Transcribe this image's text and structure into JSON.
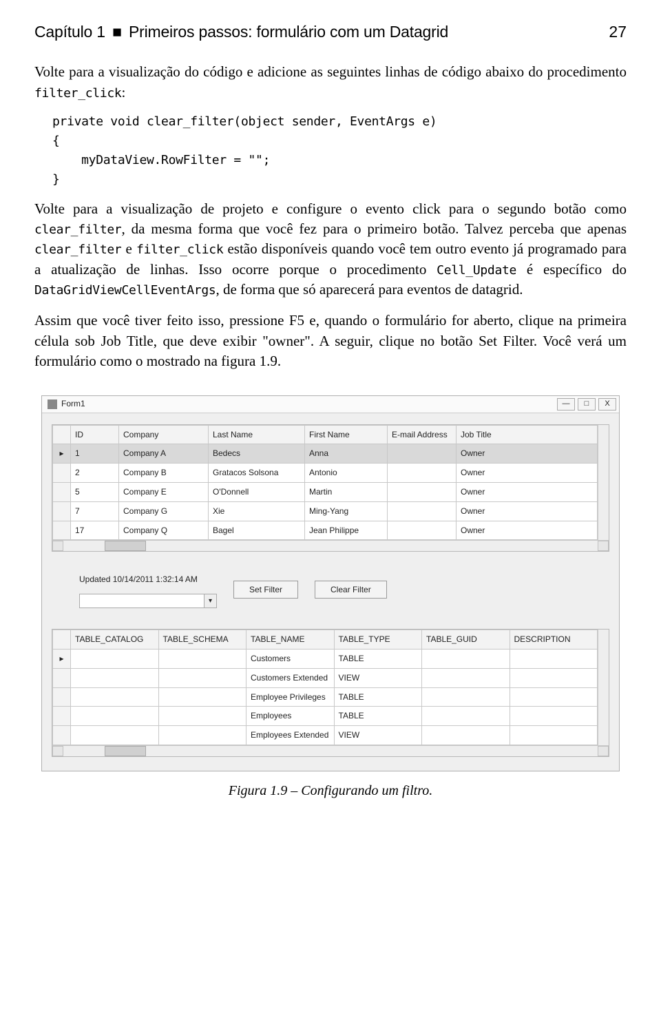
{
  "header": {
    "chapter_label": "Capítulo 1",
    "separator": "■",
    "chapter_subtitle": "Primeiros passos: formulário com um Datagrid",
    "page_number": "27"
  },
  "paragraphs": {
    "p1_a": "Volte para a visualização do código e adicione as seguintes linhas de código abaixo do procedimento ",
    "p1_code": "filter_click",
    "p1_b": ":",
    "code_block": "private void clear_filter(object sender, EventArgs e)\n{\n    myDataView.RowFilter = \"\";\n}",
    "p2_a": "Volte para a visualização de projeto e configure o evento click para o segundo botão como ",
    "p2_code1": "clear_filter",
    "p2_b": ", da mesma forma que você fez para o primeiro botão. Talvez perceba que apenas ",
    "p2_code2": "clear_filter",
    "p2_c": " e ",
    "p2_code3": "filter_click",
    "p2_d": " estão disponíveis quando você tem outro evento já programado para a atualização de linhas. Isso ocorre porque o procedimento ",
    "p2_code4": "Cell_Update",
    "p2_e": " é específico do ",
    "p2_code5": "DataGridViewCellEventArgs",
    "p2_f": ", de forma que só aparecerá para eventos de datagrid.",
    "p3": "Assim que você tiver feito isso, pressione F5 e, quando o formulário for aberto, clique na primeira célula sob Job Title, que deve exibir \"owner\". A seguir, clique no botão Set Filter. Você verá um formulário como o mostrado na figura 1.9."
  },
  "window": {
    "title": "Form1",
    "btn_min": "—",
    "btn_max": "□",
    "btn_close": "X",
    "grid1": {
      "headers": [
        "ID",
        "Company",
        "Last Name",
        "First Name",
        "E-mail Address",
        "Job Title"
      ],
      "rows": [
        {
          "sel": true,
          "cells": [
            "1",
            "Company A",
            "Bedecs",
            "Anna",
            "",
            "Owner"
          ]
        },
        {
          "sel": false,
          "cells": [
            "2",
            "Company B",
            "Gratacos Solsona",
            "Antonio",
            "",
            "Owner"
          ]
        },
        {
          "sel": false,
          "cells": [
            "5",
            "Company E",
            "O'Donnell",
            "Martin",
            "",
            "Owner"
          ]
        },
        {
          "sel": false,
          "cells": [
            "7",
            "Company G",
            "Xie",
            "Ming-Yang",
            "",
            "Owner"
          ]
        },
        {
          "sel": false,
          "cells": [
            "17",
            "Company Q",
            "Bagel",
            "Jean Philippe",
            "",
            "Owner"
          ]
        }
      ]
    },
    "status_line": "Updated 10/14/2011 1:32:14 AM",
    "btn_set": "Set Filter",
    "btn_clear": "Clear Filter",
    "grid2": {
      "headers": [
        "TABLE_CATALOG",
        "TABLE_SCHEMA",
        "TABLE_NAME",
        "TABLE_TYPE",
        "TABLE_GUID",
        "DESCRIPTION"
      ],
      "rows": [
        {
          "cells": [
            "",
            "",
            "Customers",
            "TABLE",
            "",
            ""
          ]
        },
        {
          "cells": [
            "",
            "",
            "Customers Extended",
            "VIEW",
            "",
            ""
          ]
        },
        {
          "cells": [
            "",
            "",
            "Employee Privileges",
            "TABLE",
            "",
            ""
          ]
        },
        {
          "cells": [
            "",
            "",
            "Employees",
            "TABLE",
            "",
            ""
          ]
        },
        {
          "cells": [
            "",
            "",
            "Employees Extended",
            "VIEW",
            "",
            ""
          ]
        }
      ]
    }
  },
  "caption": "Figura 1.9 – Configurando um filtro."
}
